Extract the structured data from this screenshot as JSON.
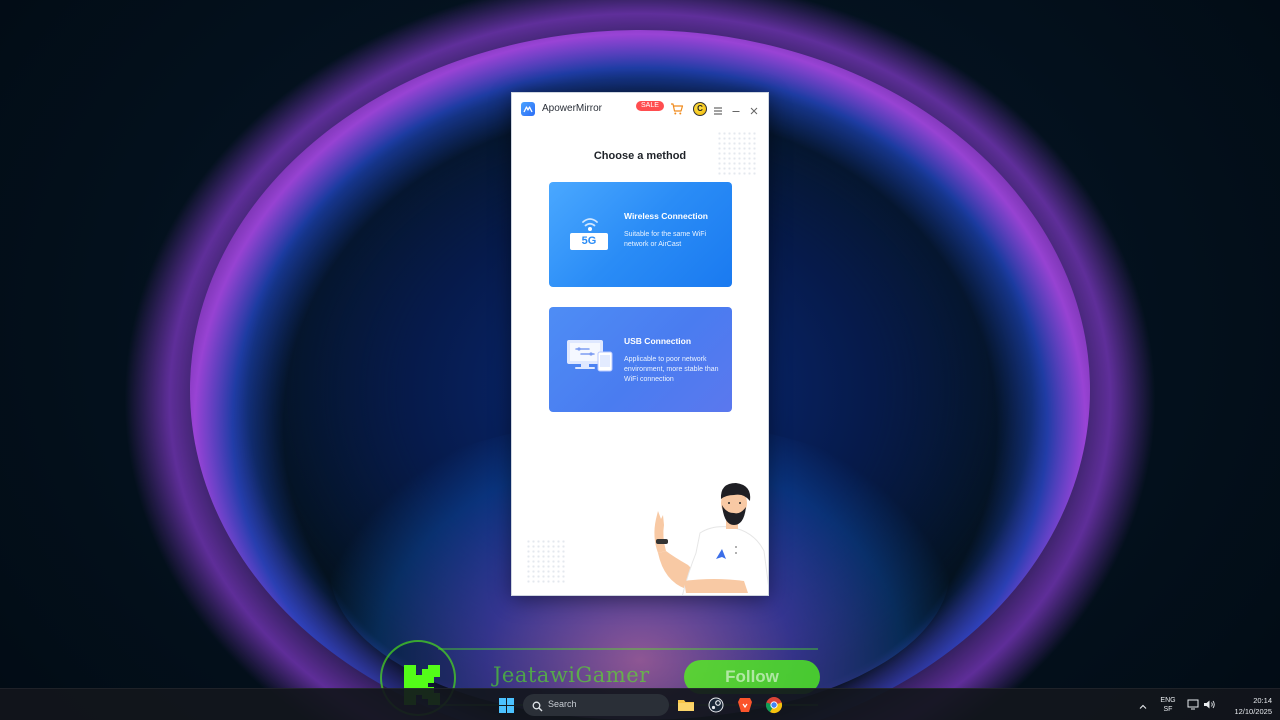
{
  "app": {
    "title": "ApowerMirror",
    "sale_badge": "SALE",
    "vip_badge": "C",
    "icons": {
      "logo": "apowermirror-logo-icon",
      "cart": "cart-icon",
      "vip": "vip-crown-icon",
      "menu": "menu-icon",
      "minimize": "minimize-icon",
      "close": "close-icon"
    }
  },
  "main": {
    "heading": "Choose a method",
    "methods": [
      {
        "title": "Wireless Connection",
        "description": "Suitable for the same WiFi network or AirCast",
        "icon": "wifi-5g-icon",
        "icon_text": "5G"
      },
      {
        "title": "USB Connection",
        "description": "Applicable to poor network environment, more stable than WiFi connection",
        "icon": "usb-devices-icon"
      }
    ],
    "illustration": "man-waving-illustration"
  },
  "overlay": {
    "platform_logo": "K",
    "streamer_name": "JeatawiGamer",
    "follow_label": "Follow",
    "accent_color": "#53fc18"
  },
  "taskbar": {
    "search_placeholder": "Search",
    "pinned": [
      "start-icon",
      "file-explorer-icon",
      "steam-icon",
      "brave-icon",
      "chrome-icon"
    ],
    "language_line1": "ENG",
    "language_line2": "SF",
    "time": "20:14",
    "date": "12/10/2025"
  },
  "colors": {
    "wireless_card": "#2a8cf6",
    "usb_card": "#4a7cf0",
    "sale": "#ff4d4f"
  }
}
